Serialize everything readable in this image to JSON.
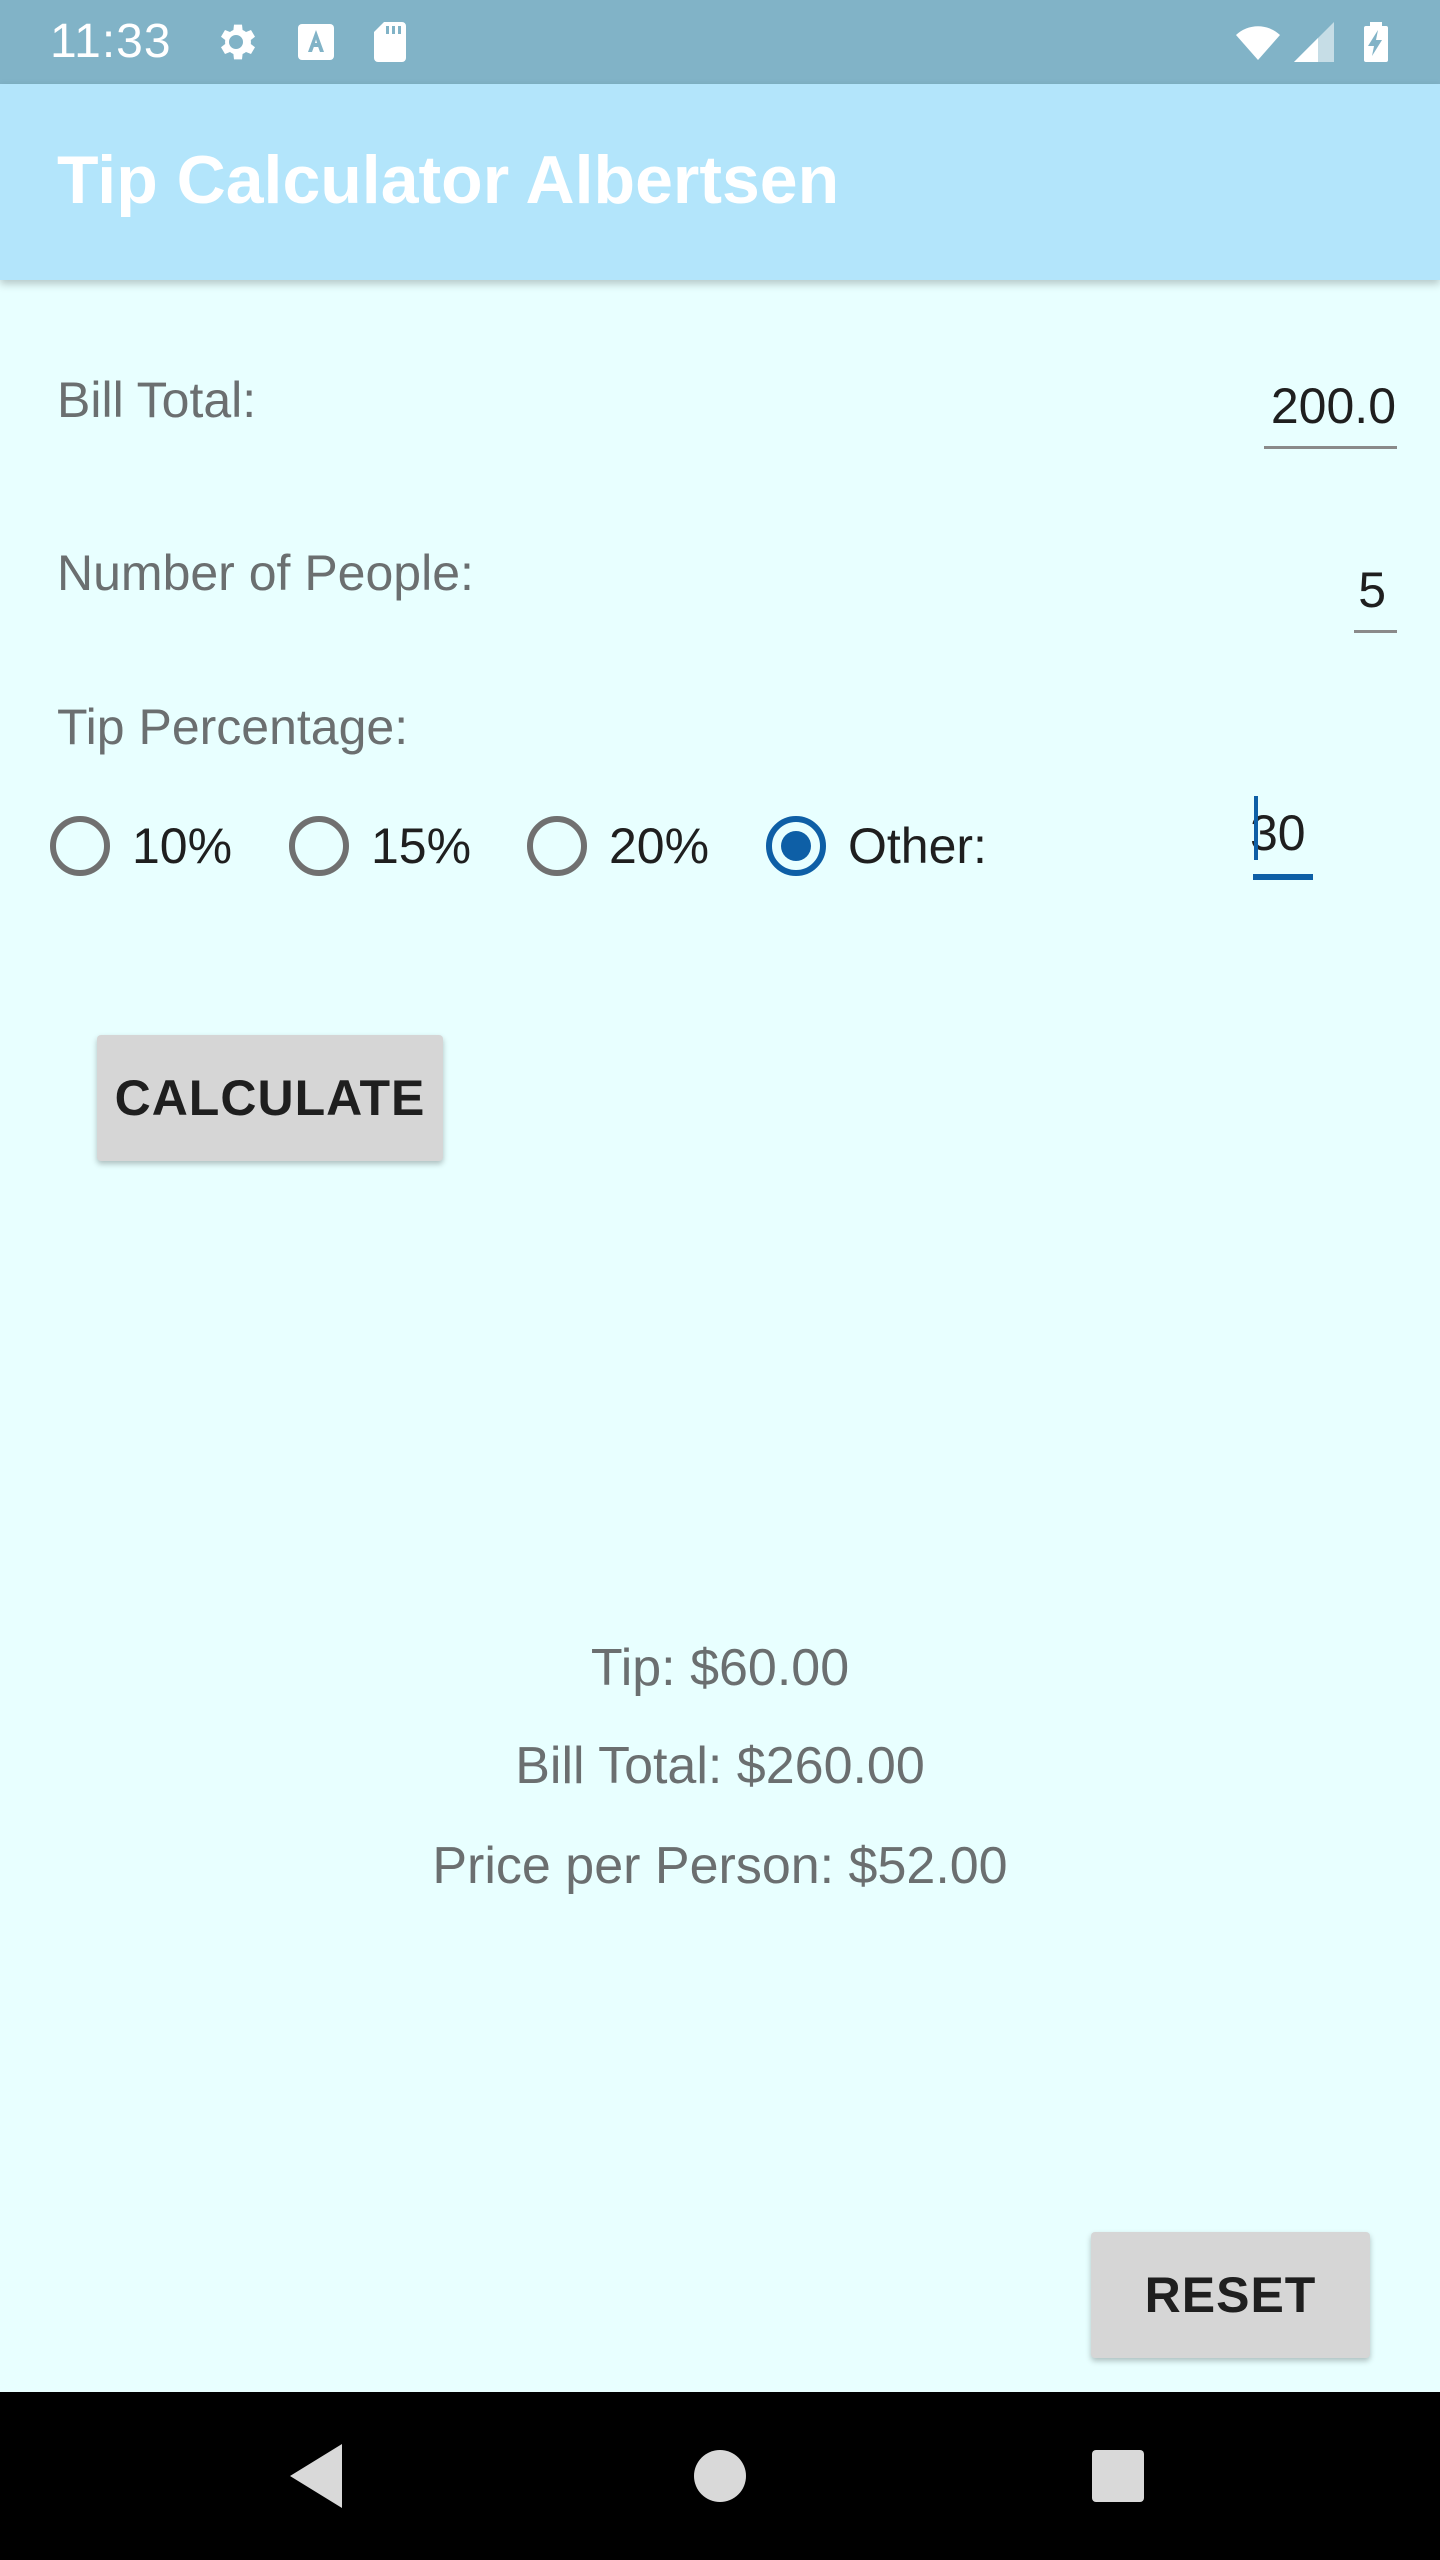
{
  "status_bar": {
    "time": "11:33",
    "icons": [
      "gear-icon",
      "text-a-icon",
      "sd-card-icon",
      "wifi-icon",
      "cell-signal-icon",
      "battery-charging-icon"
    ]
  },
  "app_bar": {
    "title": "Tip Calculator Albertsen",
    "color": "#b3e5fb"
  },
  "form": {
    "bill_total_label": "Bill Total:",
    "bill_total_value": "200.0",
    "people_label": "Number of People:",
    "people_value": "5",
    "tip_label": "Tip Percentage:",
    "tip_options": [
      "10%",
      "15%",
      "20%",
      "Other:"
    ],
    "selected_option": "Other:",
    "other_value": "30",
    "accent_color": "#0e5fa6"
  },
  "buttons": {
    "calculate_label": "CALCULATE",
    "reset_label": "RESET"
  },
  "results": {
    "tip": "Tip: $60.00",
    "bill_total": "Bill Total: $260.00",
    "price_per_person": "Price per Person: $52.00"
  },
  "nav_bar": {
    "icons": [
      "back-icon",
      "home-icon",
      "recents-icon"
    ]
  }
}
